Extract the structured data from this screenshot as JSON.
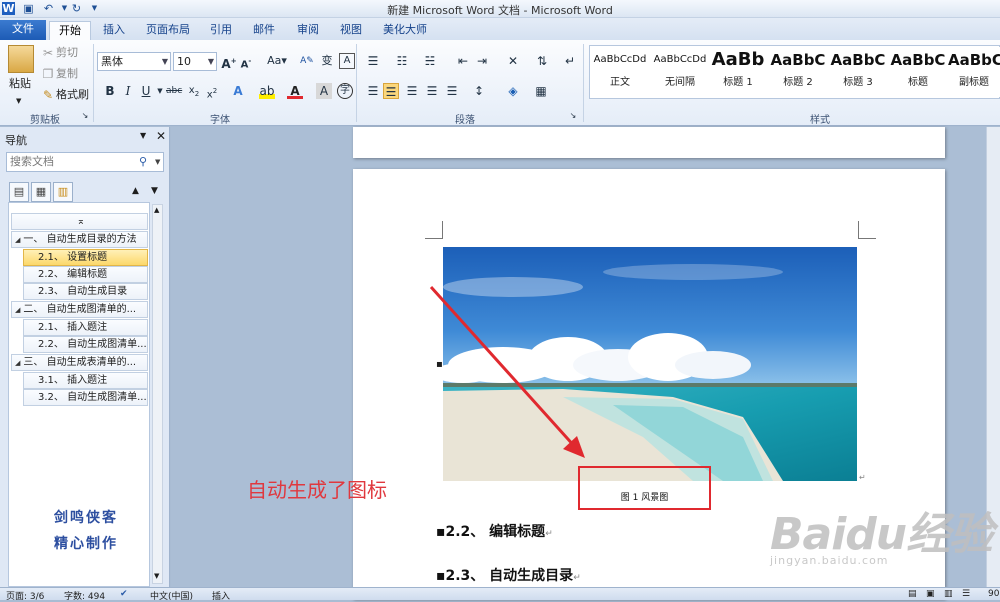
{
  "window": {
    "title": "新建 Microsoft Word 文档 - Microsoft Word"
  },
  "ribbon_tabs": [
    "文件",
    "开始",
    "插入",
    "页面布局",
    "引用",
    "邮件",
    "审阅",
    "视图",
    "美化大师"
  ],
  "clipboard": {
    "paste": "粘贴",
    "cut": "剪切",
    "copy": "复制",
    "format_painter": "格式刷",
    "group": "剪贴板"
  },
  "font": {
    "name": "黑体",
    "size": "10",
    "group": "字体"
  },
  "paragraph": {
    "group": "段落"
  },
  "styles": {
    "group": "样式",
    "items": [
      {
        "sample": "AaBbCcDd",
        "name": "正文"
      },
      {
        "sample": "AaBbCcDd",
        "name": "无间隔"
      },
      {
        "sample": "AaBb",
        "name": "标题 1"
      },
      {
        "sample": "AaBbC",
        "name": "标题 2"
      },
      {
        "sample": "AaBbC",
        "name": "标题 3"
      },
      {
        "sample": "AaBbC",
        "name": "标题"
      },
      {
        "sample": "AaBbC",
        "name": "副标题"
      }
    ]
  },
  "nav": {
    "title": "导航",
    "search_placeholder": "搜索文档",
    "items": [
      {
        "text": "一、 自动生成目录的方法",
        "level": 1
      },
      {
        "text": "2.1、 设置标题",
        "level": 2,
        "selected": true
      },
      {
        "text": "2.2、 编辑标题",
        "level": 2
      },
      {
        "text": "2.3、 自动生成目录",
        "level": 2
      },
      {
        "text": "二、 自动生成图清单的...",
        "level": 1
      },
      {
        "text": "2.1、 插入题注",
        "level": 2
      },
      {
        "text": "2.2、 自动生成图清单...",
        "level": 2
      },
      {
        "text": "三、 自动生成表清单的...",
        "level": 1
      },
      {
        "text": "3.1、 插入题注",
        "level": 2
      },
      {
        "text": "3.2、 自动生成图清单...",
        "level": 2
      }
    ],
    "signature_line1": "剑鸣侠客",
    "signature_line2": "精心制作"
  },
  "document": {
    "caption": "图 1 风景图",
    "heading_22": "2.2、 编辑标题",
    "heading_23": "2.3、 自动生成目录",
    "annotation": "自动生成了图标"
  },
  "status": {
    "page": "页面: 3/6",
    "words": "字数: 494",
    "language": "中文(中国)",
    "mode": "插入",
    "zoom": "90"
  },
  "watermark": {
    "main": "Baidu经验",
    "sub": "jingyan.baidu.com"
  },
  "colors": {
    "accent_red": "#e0292f",
    "file_tab": "#2a67c0",
    "selected_node": "#fcd86b"
  }
}
